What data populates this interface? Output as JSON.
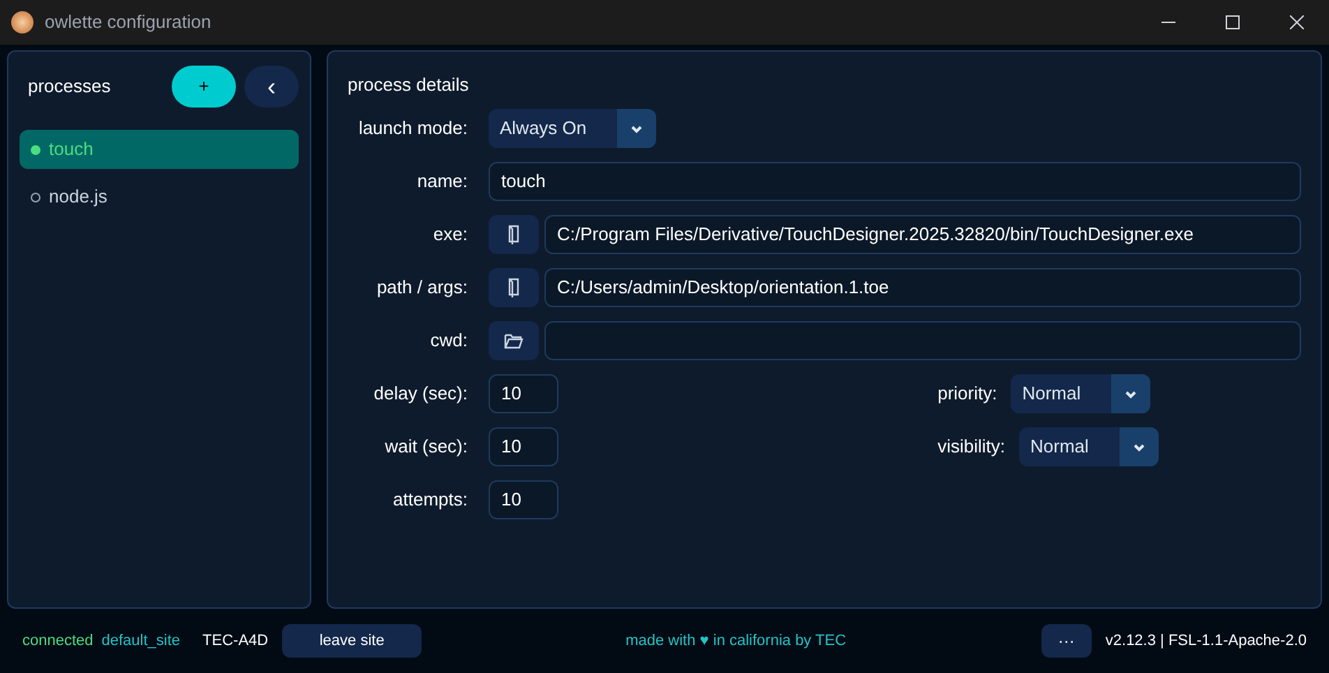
{
  "window": {
    "title": "owlette configuration"
  },
  "sidebar": {
    "title": "processes",
    "add_button": "+",
    "collapse_button": "‹",
    "items": [
      {
        "label": "touch",
        "selected": true,
        "running": true
      },
      {
        "label": "node.js",
        "selected": false,
        "running": false
      }
    ]
  },
  "details": {
    "title": "process details",
    "launch_mode": {
      "label": "launch mode:",
      "value": "Always On"
    },
    "fields": [
      {
        "kind": "text",
        "label": "name:",
        "value": "touch"
      },
      {
        "kind": "file",
        "label": "exe:",
        "value": "C:/Program Files/Derivative/TouchDesigner.2025.32820/bin/TouchDesigner.exe"
      },
      {
        "kind": "file",
        "label": "path / args:",
        "value": "C:/Users/admin/Desktop/orientation.1.toe"
      },
      {
        "kind": "folder",
        "label": "cwd:"
      }
    ],
    "numbers": [
      {
        "label": "delay (sec):",
        "value": "10"
      },
      {
        "label": "wait (sec):",
        "value": "10"
      },
      {
        "label": "attempts:",
        "value": "10"
      }
    ],
    "selects": [
      {
        "label": "priority:",
        "value": "Normal"
      },
      {
        "label": "visibility:",
        "value": "Normal"
      }
    ]
  },
  "status_bar": {
    "connection": "connected",
    "site": "default_site",
    "machine": "TEC-A4D",
    "leave_button": "leave site",
    "credit": "made with ♥ in california by TEC",
    "more_button": "···",
    "version": "v2.12.3 | FSL-1.1-Apache-2.0"
  }
}
